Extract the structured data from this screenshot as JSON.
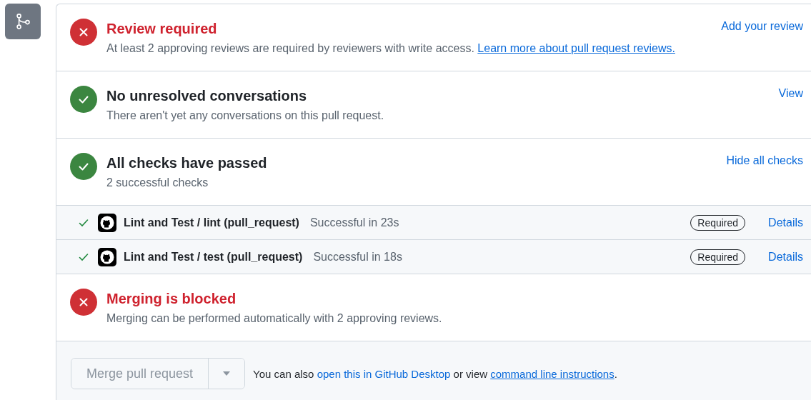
{
  "sections": [
    {
      "kind": "failure",
      "title": "Review required",
      "description": "At least 2 approving reviews are required by reviewers with write access.",
      "link": "Learn more about pull request reviews.",
      "action": "Add your review"
    },
    {
      "kind": "success",
      "title": "No unresolved conversations",
      "description": "There aren't yet any conversations on this pull request.",
      "action": "View"
    },
    {
      "kind": "success",
      "title": "All checks have passed",
      "description": "2 successful checks",
      "action": "Hide all checks"
    }
  ],
  "checks": [
    {
      "kind": "success",
      "name": "Lint and Test / lint (pull_request)",
      "result": "Successful in 23s",
      "badge": "Required",
      "action": "Details"
    },
    {
      "kind": "success",
      "name": "Lint and Test / test (pull_request)",
      "result": "Successful in 18s",
      "badge": "Required",
      "action": "Details"
    }
  ],
  "merge_status": {
    "kind": "failure",
    "title": "Merging is blocked",
    "description": "Merging can be performed automatically with 2 approving reviews."
  },
  "merge": {
    "button": "Merge pull request",
    "disabled": true,
    "note_start": "You can also",
    "desktop_link": "open this in GitHub Desktop",
    "note_middle": "or view",
    "cli_link": "command line instructions",
    "note_end": "."
  }
}
